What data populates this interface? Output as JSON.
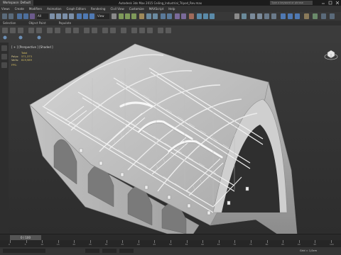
{
  "title_bar": {
    "app_name": "Workspace: Default",
    "document": "Autodesk 3ds Max 2015   Ceiling_Industrial_Tripod_Rev.max",
    "search_placeholder": "Type a keyword or phrase"
  },
  "menu": [
    "Views",
    "Create",
    "Modifiers",
    "Animation",
    "Graph Editors",
    "Rendering",
    "Civil View",
    "Customize",
    "MAXScript",
    "Help"
  ],
  "toolbar": {
    "selection_filter": "All",
    "view_dropdown": "View"
  },
  "ribbon_tabs": [
    "Selection",
    "Object Paint",
    "Populate"
  ],
  "viewport": {
    "label": "[ + ] [Perspective ] [Shaded ]",
    "stats": {
      "total_label": "Total",
      "polys_label": "Polys:",
      "polys_value": "571,373",
      "verts_label": "Verts:",
      "verts_value": "619,989",
      "fps_label": "FPS:"
    }
  },
  "timeline": {
    "frame_label": "0 / 100",
    "ruler_ticks": [
      "0",
      "5",
      "10",
      "15",
      "20",
      "25",
      "30",
      "35",
      "40",
      "45",
      "50",
      "55",
      "60",
      "65",
      "70",
      "75",
      "80",
      "85",
      "90",
      "95",
      "100"
    ]
  },
  "status": {
    "grid_label": "Grid = 1,0cm"
  },
  "colors": {
    "stats_text": "#d8c060",
    "viewport_bg": "#333333",
    "model_fill": "#cfcfcf",
    "model_edge": "#9a9a9a"
  }
}
